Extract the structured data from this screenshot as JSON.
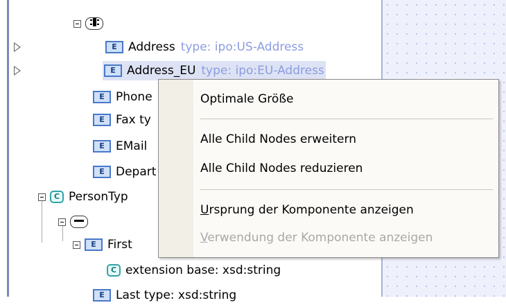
{
  "tree": {
    "compositor_top_icon": "sequence-compositor-icon",
    "nodes": [
      {
        "badge": "E",
        "name": "Address",
        "type": "type: ipo:US-Address"
      },
      {
        "badge": "E",
        "name": "Address_EU",
        "type": "type: ipo:EU-Address"
      },
      {
        "badge": "E",
        "name": "Phone"
      },
      {
        "badge": "E",
        "name": "Fax  ty"
      },
      {
        "badge": "E",
        "name": "EMail"
      },
      {
        "badge": "E",
        "name": "Depart"
      },
      {
        "badge": "C",
        "name": "PersonTyp"
      },
      {
        "badge": "E",
        "name": "First"
      },
      {
        "badge": "C",
        "name": "extension base: xsd:string"
      },
      {
        "badge": "E",
        "name": "Last  type: xsd:string"
      }
    ]
  },
  "context_menu": {
    "items": [
      {
        "label": "Optimale Größe",
        "enabled": true
      },
      {
        "label": "Alle Child Nodes erweitern",
        "enabled": true
      },
      {
        "label": "Alle Child Nodes reduzieren",
        "enabled": true
      },
      {
        "label": "Ursprung der Komponente anzeigen",
        "enabled": true
      },
      {
        "label": "Verwendung der Komponente anzeigen",
        "enabled": false
      }
    ]
  }
}
